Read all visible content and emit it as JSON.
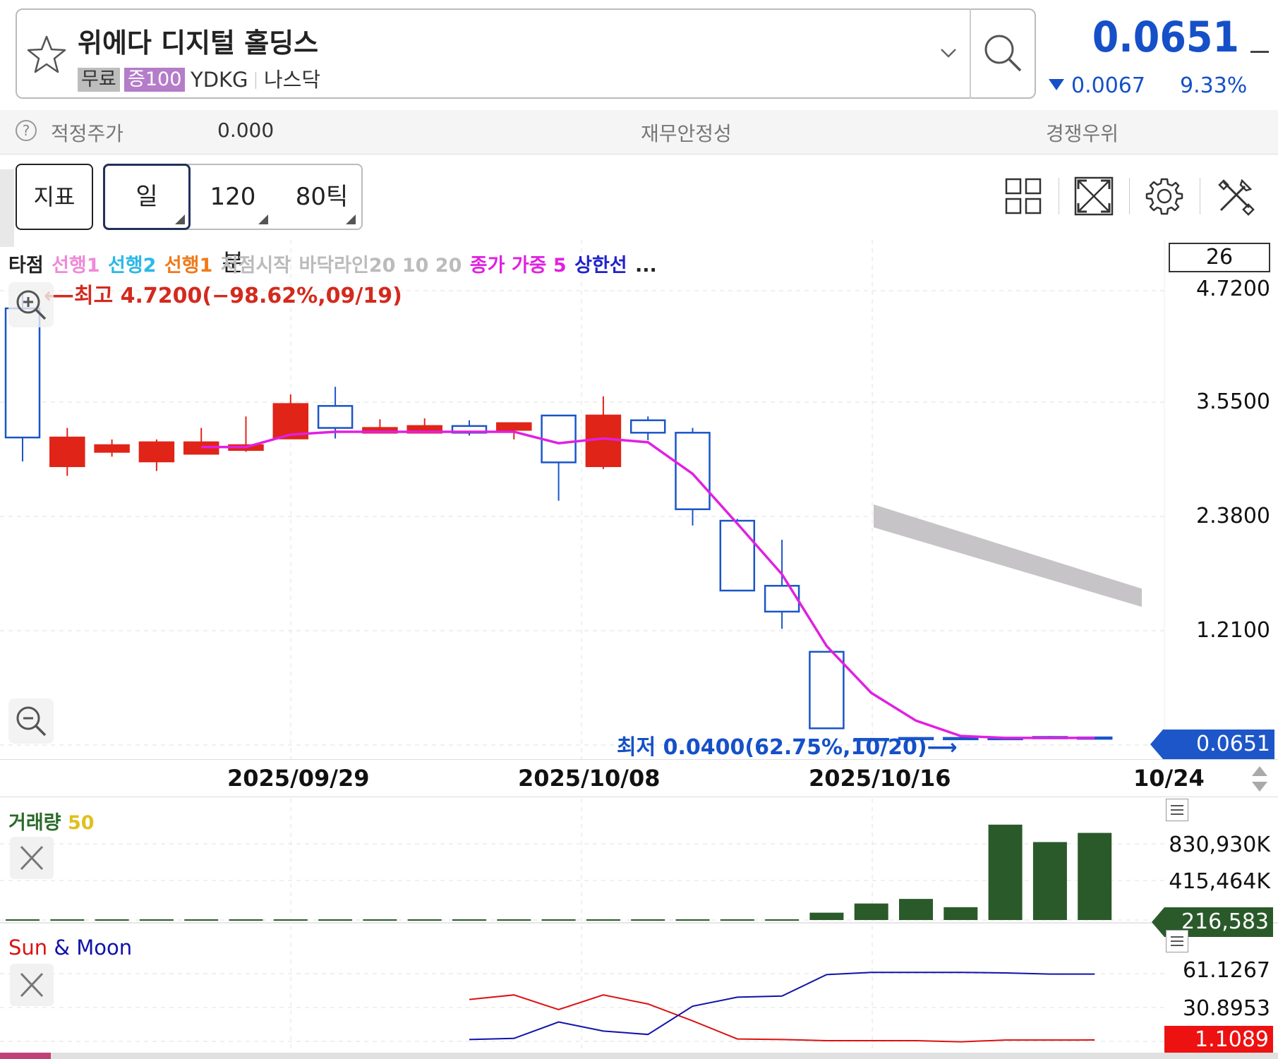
{
  "header": {
    "stock_name": "위에다 디지털 홀딩스",
    "tag_free": "무료",
    "tag_margin": "증100",
    "ticker": "YDKG",
    "exchange": "나스닥",
    "price": "0.0651",
    "change": "0.0067",
    "change_pct": "9.33%",
    "change_direction": "down",
    "price_color": "#1550c8"
  },
  "info_bar": {
    "fair_price_label": "적정주가",
    "fair_price_value": "0.000",
    "financial_stability_label": "재무안정성",
    "competitive_advantage_label": "경쟁우위"
  },
  "toolbar": {
    "indicator_button": "지표",
    "period_day": "일",
    "period_120min": "120분",
    "period_80tick": "80틱",
    "icons": [
      "layout-grid-icon",
      "fullscreen-icon",
      "settings-gear-icon",
      "tools-icon"
    ]
  },
  "legend": [
    {
      "text": "타점 ",
      "color": "#222222"
    },
    {
      "text": "선행1 ",
      "color": "#f08ad8"
    },
    {
      "text": "선행2 ",
      "color": "#2bb8e8"
    },
    {
      "text": "선행1 ",
      "color": "#f07a1a"
    },
    {
      "text": "저점시작 ",
      "color": "#bbbbbb"
    },
    {
      "text": "바닥라인20 10 20 ",
      "color": "#bbbbbb"
    },
    {
      "text": "종가 가중 5 ",
      "color": "#e020e0"
    },
    {
      "text": "상한선 ",
      "color": "#2222cc"
    },
    {
      "text": "...",
      "color": "#222222"
    }
  ],
  "visible_count": "26",
  "annotations": {
    "high": "최고 4.7200(−98.62%,09/19)",
    "low": "최저 0.0400(62.75%,10/20)"
  },
  "price_axis": {
    "labels": [
      "4.7200",
      "3.5500",
      "2.3800",
      "1.2100"
    ],
    "current_tag": "0.0651"
  },
  "date_axis": [
    "2025/09/29",
    "2025/10/08",
    "2025/10/16",
    "10/24"
  ],
  "volume_panel": {
    "title": "거래량",
    "title_param": "50",
    "labels": [
      "830,930K",
      "415,464K"
    ],
    "current_tag": "216,583"
  },
  "sun_moon_panel": {
    "title_sun": "Sun",
    "title_amp": " & ",
    "title_moon": "Moon",
    "labels": [
      "61.1267",
      "30.8953"
    ],
    "current_tag": "1.1089"
  },
  "chart_data": {
    "type": "candlestick",
    "price_range": [
      0,
      4.72
    ],
    "up_color": "#1a55c8",
    "down_color": "#e02418",
    "candles": [
      {
        "o": 3.2,
        "h": 4.72,
        "l": 2.95,
        "c": 4.55
      },
      {
        "o": 3.2,
        "h": 3.3,
        "l": 2.8,
        "c": 2.9
      },
      {
        "o": 3.12,
        "h": 3.18,
        "l": 3.0,
        "c": 3.05
      },
      {
        "o": 3.15,
        "h": 3.18,
        "l": 2.85,
        "c": 2.95
      },
      {
        "o": 3.15,
        "h": 3.3,
        "l": 3.03,
        "c": 3.03
      },
      {
        "o": 3.12,
        "h": 3.42,
        "l": 3.05,
        "c": 3.07
      },
      {
        "o": 3.55,
        "h": 3.65,
        "l": 3.19,
        "c": 3.19
      },
      {
        "o": 3.3,
        "h": 3.73,
        "l": 3.19,
        "c": 3.53
      },
      {
        "o": 3.3,
        "h": 3.39,
        "l": 3.25,
        "c": 3.25
      },
      {
        "o": 3.32,
        "h": 3.4,
        "l": 3.25,
        "c": 3.25
      },
      {
        "o": 3.25,
        "h": 3.38,
        "l": 3.22,
        "c": 3.32
      },
      {
        "o": 3.35,
        "h": 3.36,
        "l": 3.18,
        "c": 3.28
      },
      {
        "o": 2.94,
        "h": 3.43,
        "l": 2.54,
        "c": 3.43
      },
      {
        "o": 3.43,
        "h": 3.63,
        "l": 2.87,
        "c": 2.9
      },
      {
        "o": 3.25,
        "h": 3.42,
        "l": 3.17,
        "c": 3.38
      },
      {
        "o": 2.45,
        "h": 3.3,
        "l": 2.28,
        "c": 3.25
      },
      {
        "o": 1.6,
        "h": 2.35,
        "l": 1.6,
        "c": 2.33
      },
      {
        "o": 1.38,
        "h": 2.13,
        "l": 1.2,
        "c": 1.65
      },
      {
        "o": 0.16,
        "h": 0.96,
        "l": 0.16,
        "c": 0.96
      },
      {
        "o": 0.05,
        "h": 0.06,
        "l": 0.04,
        "c": 0.05
      },
      {
        "o": 0.06,
        "h": 0.07,
        "l": 0.05,
        "c": 0.06
      },
      {
        "o": 0.06,
        "h": 0.07,
        "l": 0.05,
        "c": 0.06
      },
      {
        "o": 0.06,
        "h": 0.07,
        "l": 0.05,
        "c": 0.06
      },
      {
        "o": 0.07,
        "h": 0.08,
        "l": 0.06,
        "c": 0.07
      },
      {
        "o": 0.06,
        "h": 0.07,
        "l": 0.06,
        "c": 0.0651
      }
    ],
    "ma_close_weighted_5": [
      null,
      null,
      null,
      null,
      3.1,
      3.1,
      3.23,
      3.26,
      3.26,
      3.26,
      3.26,
      3.26,
      3.14,
      3.19,
      3.15,
      2.82,
      2.3,
      1.77,
      1.02,
      0.53,
      0.24,
      0.08,
      0.06,
      0.06,
      0.06
    ],
    "cloud": {
      "x_start_index": 19,
      "x_end_index": 25,
      "top_start": 2.5,
      "bottom_start": 2.26,
      "top_end": 1.62,
      "bottom_end": 1.43,
      "color": "#c7c4c7"
    },
    "volume_max": 830930,
    "volume": [
      0,
      0,
      0,
      0,
      0,
      0,
      0,
      0,
      0,
      0,
      0,
      0,
      0,
      0,
      0,
      0,
      0,
      0,
      80000,
      180000,
      230000,
      140000,
      1040000,
      850000,
      950000
    ],
    "volume_color": "#2a5a2a",
    "sun_moon_range": [
      1.1089,
      61.1267
    ],
    "sun": [
      null,
      null,
      null,
      null,
      null,
      null,
      null,
      null,
      null,
      null,
      37,
      41,
      28,
      41,
      33,
      18,
      2,
      1.5,
      0.5,
      0.5,
      0.5,
      -0.5,
      1,
      1,
      1.1089
    ],
    "moon": [
      null,
      null,
      null,
      null,
      null,
      null,
      null,
      null,
      null,
      null,
      1.5,
      2.5,
      17,
      9,
      6,
      31,
      39,
      40,
      59,
      61,
      61,
      61,
      60.5,
      59.5,
      59.5
    ],
    "sun_color": "#dd1111",
    "moon_color": "#1111aa"
  }
}
